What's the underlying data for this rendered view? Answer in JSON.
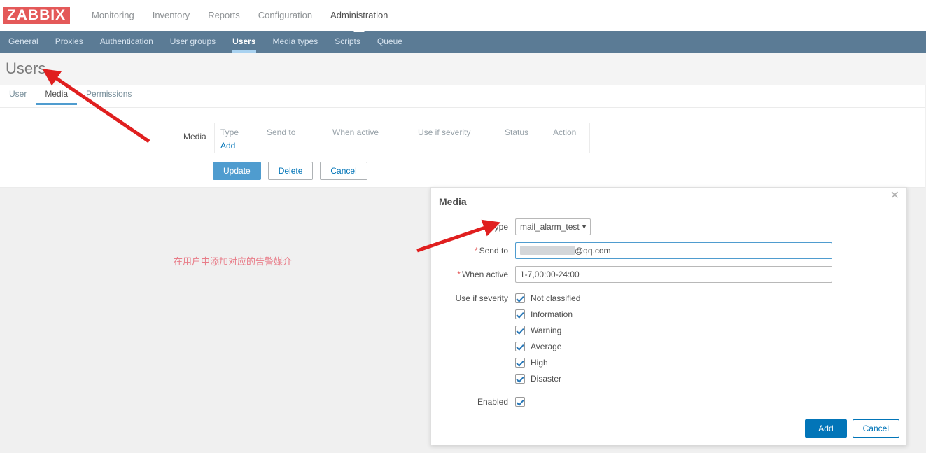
{
  "header": {
    "logo_text": "ZABBIX",
    "logo_bg": "#e45959",
    "menu": [
      {
        "label": "Monitoring",
        "active": false
      },
      {
        "label": "Inventory",
        "active": false
      },
      {
        "label": "Reports",
        "active": false
      },
      {
        "label": "Configuration",
        "active": false
      },
      {
        "label": "Administration",
        "active": true
      }
    ]
  },
  "subnav": {
    "bg": "#5b7b95",
    "items": [
      {
        "label": "General",
        "active": false
      },
      {
        "label": "Proxies",
        "active": false
      },
      {
        "label": "Authentication",
        "active": false
      },
      {
        "label": "User groups",
        "active": false
      },
      {
        "label": "Users",
        "active": true
      },
      {
        "label": "Media types",
        "active": false
      },
      {
        "label": "Scripts",
        "active": false
      },
      {
        "label": "Queue",
        "active": false
      }
    ]
  },
  "page": {
    "title": "Users"
  },
  "form": {
    "tabs": [
      {
        "label": "User",
        "active": false
      },
      {
        "label": "Media",
        "active": true
      },
      {
        "label": "Permissions",
        "active": false
      }
    ],
    "media_field_label": "Media",
    "table": {
      "columns": [
        "Type",
        "Send to",
        "When active",
        "Use if severity",
        "Status",
        "Action"
      ],
      "rows": [],
      "add_link": "Add"
    },
    "buttons": {
      "update": "Update",
      "delete": "Delete",
      "cancel": "Cancel"
    }
  },
  "annotation": {
    "note": "在用户中添加对应的告警媒介",
    "note_color": "#e87c88",
    "arrow_color": "#e01f1f"
  },
  "modal": {
    "title": "Media",
    "close_icon": "close-icon",
    "fields": {
      "type": {
        "label": "Type",
        "value": "mail_alarm_test",
        "caret": "▼"
      },
      "send_to": {
        "label": "Send to",
        "required": true,
        "value_suffix": "@qq.com",
        "redacted": true
      },
      "when_active": {
        "label": "When active",
        "required": true,
        "value": "1-7,00:00-24:00"
      },
      "use_if_severity": {
        "label": "Use if severity",
        "options": [
          {
            "label": "Not classified",
            "checked": true
          },
          {
            "label": "Information",
            "checked": true
          },
          {
            "label": "Warning",
            "checked": true
          },
          {
            "label": "Average",
            "checked": true
          },
          {
            "label": "High",
            "checked": true
          },
          {
            "label": "Disaster",
            "checked": true
          }
        ]
      },
      "enabled": {
        "label": "Enabled",
        "checked": true
      }
    },
    "footer": {
      "add": "Add",
      "cancel": "Cancel"
    }
  }
}
